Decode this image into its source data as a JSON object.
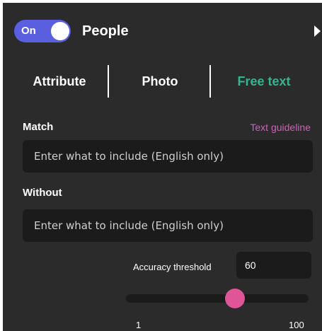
{
  "header": {
    "toggle_label": "On",
    "toggle_on": true,
    "title": "People",
    "expand_icon": "triangle-right-icon"
  },
  "tabs": [
    {
      "label": "Attribute",
      "active": false
    },
    {
      "label": "Photo",
      "active": false
    },
    {
      "label": "Free text",
      "active": true
    }
  ],
  "match": {
    "label": "Match",
    "guideline_link": "Text guideline",
    "placeholder": "Enter what to include (English only)"
  },
  "without": {
    "label": "Without",
    "placeholder": "Enter what to include (English only)"
  },
  "threshold": {
    "label": "Accuracy threshold",
    "value": "60",
    "slider_min": "1",
    "slider_max": "100",
    "slider_value": 60
  },
  "colors": {
    "panel_bg": "#2b2b2b",
    "field_bg": "#1b1b1b",
    "toggle_accent": "#5a5fe0",
    "active_tab": "#36b38f",
    "link": "#c864b4",
    "slider_thumb": "#e05598"
  }
}
